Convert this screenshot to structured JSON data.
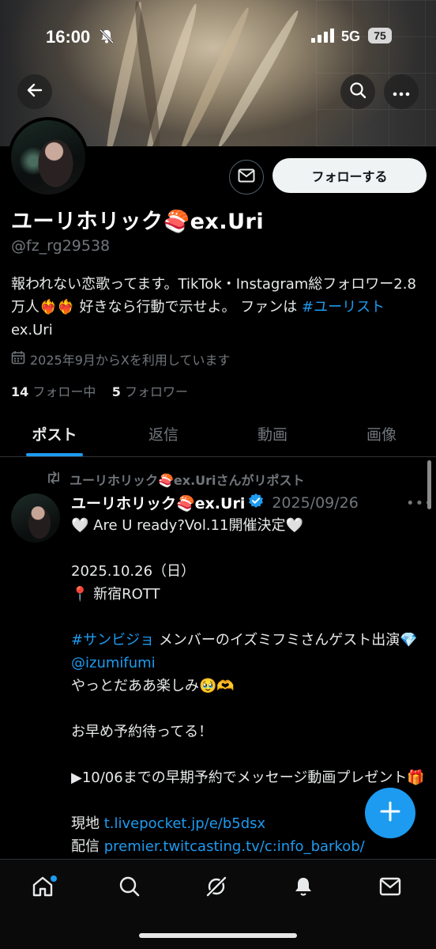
{
  "status_bar": {
    "time": "16:00",
    "network": "5G",
    "battery": "75"
  },
  "profile": {
    "follow_label": "フォローする",
    "display_name": "ユーリホリック🍣ex.Uri",
    "handle": "@fz_rg29538",
    "bio_text": "報われない恋歌ってます。TikTok・Instagram総フォロワー2.8万人❤️‍🔥❤️‍🔥 好きなら行動で示せよ。 ファンは ",
    "bio_hashtag": "#ユーリスト",
    "bio_suffix": " ex.Uri",
    "joined": "2025年9月からXを利用しています",
    "following_count": "14",
    "following_label": "フォロー中",
    "followers_count": "5",
    "followers_label": "フォロワー"
  },
  "tabs": [
    {
      "label": "ポスト"
    },
    {
      "label": "返信"
    },
    {
      "label": "動画"
    },
    {
      "label": "画像"
    }
  ],
  "post": {
    "repost_label": "ユーリホリック🍣ex.Uriさんがリポスト",
    "author_name": "ユーリホリック🍣ex.Uri",
    "date": "2025/09/26",
    "line1": "🤍 Are U ready?Vol.11開催決定🤍",
    "line2": "2025.10.26（日）",
    "line3": "📍 新宿ROTT",
    "hashtag": "#サンビジョ",
    "line4": " メンバーのイズミフミさんゲスト出演💎 ",
    "mention": "@izumifumi",
    "line5": "やっとだああ楽しみ🥹🫶",
    "line6": "お早め予約待ってる！",
    "line7": "▶10/06までの早期予約でメッセージ動画プレゼント🎁",
    "line8_prefix": "現地 ",
    "link1": "t.livepocket.jp/e/b5dsx",
    "line9_prefix": "配信 ",
    "link2": "premier.twitcasting.tv/c:info_barkob/"
  },
  "colors": {
    "accent": "#1d9bf0",
    "background": "#000000",
    "muted": "#71767b"
  }
}
